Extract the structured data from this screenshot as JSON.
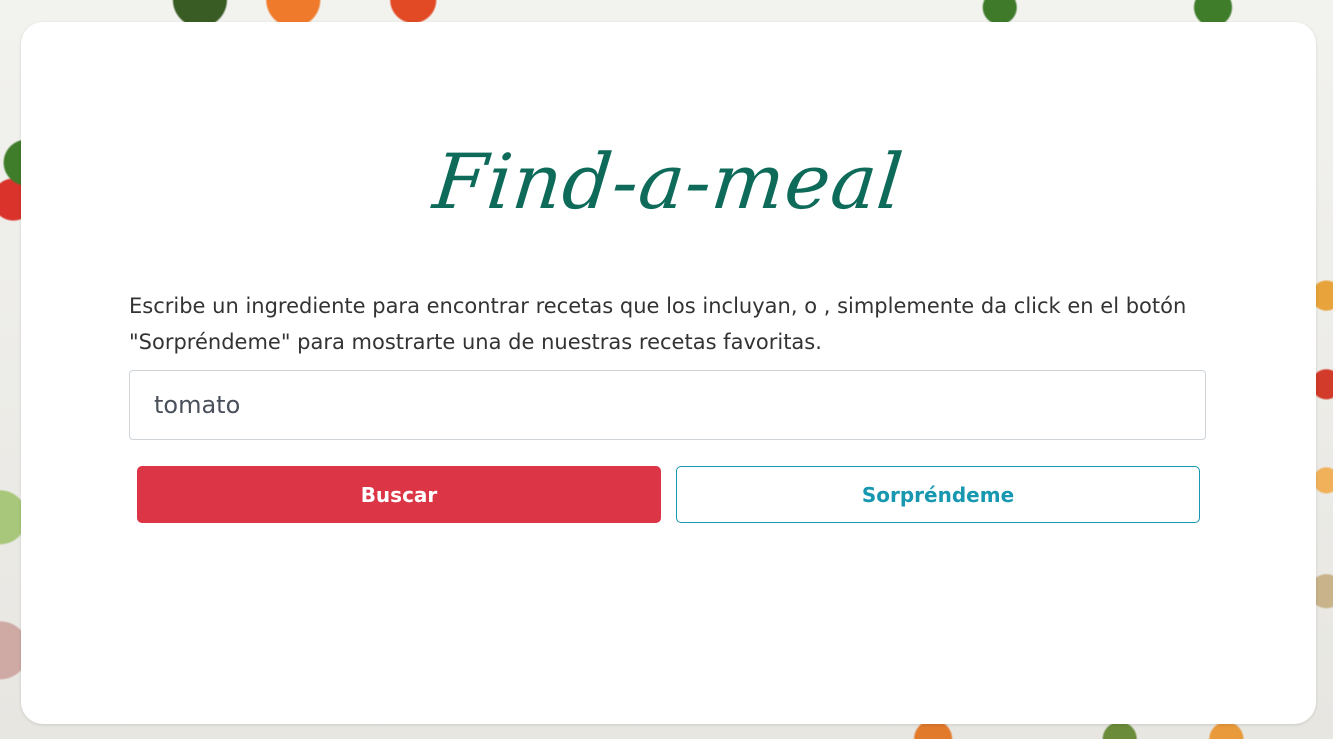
{
  "app": {
    "title": "Find-a-meal"
  },
  "intro": {
    "text": "Escribe un ingrediente para encontrar recetas que los incluyan, o , simplemente da click en el botón \"Sorpréndeme\" para mostrarte una de nuestras recetas favoritas."
  },
  "search": {
    "value": "tomato",
    "placeholder": ""
  },
  "buttons": {
    "search_label": "Buscar",
    "surprise_label": "Sorpréndeme"
  },
  "colors": {
    "title": "#0e6b5a",
    "primary": "#dc3546",
    "secondary": "#1798b0"
  }
}
